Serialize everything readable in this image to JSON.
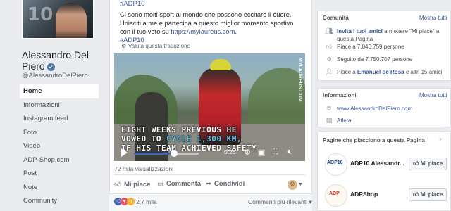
{
  "profile": {
    "photo_number": "10",
    "name": "Alessandro Del Piero",
    "verified_glyph": "✔",
    "handle": "@AlessandroDelPiero"
  },
  "nav": {
    "items": [
      "Home",
      "Informazioni",
      "Instagram feed",
      "Foto",
      "Video",
      "ADP-Shop.com",
      "Post",
      "Note",
      "Community"
    ]
  },
  "post": {
    "hashtag_top": "#ADP10",
    "text_line1": "Ci sono molti sport al mondo che possono eccitare il cuore.",
    "text_line2": "Unisciti a me e partecipa a questo miglior momento sportivo con il tuo voto su",
    "link": "https://mylaureus.com",
    "text_after_link": ".",
    "hashtag_bottom": "#ADP10",
    "translate": "Valuta questa traduzione",
    "video": {
      "watermark": "MYLAUREUS.COM",
      "caption_line1": "EIGHT WEEKS PREVIOUS HE",
      "caption_line2_a": "VOWED TO ",
      "caption_line2_b": "CYCLE 1,300 KM,",
      "caption_line3": "IF HIS TEAM ACHIEVED SAFETY",
      "progress": 0.62,
      "time": "0:26"
    },
    "views": "72 mila visualizzazioni",
    "actions": {
      "like": "Mi piace",
      "comment": "Commenta",
      "share": "Condividi"
    },
    "reactions_count": "2,7 mila",
    "comments_sort": "Commenti più rilevanti"
  },
  "community": {
    "title": "Comunità",
    "see_all": "Mostra tutti",
    "invite_link": "Invita i tuoi amici",
    "invite_rest": "a mettere \"Mi piace\" a questa Pagina",
    "likes": "Piace a 7.846.759 persone",
    "follows": "Seguito da 7.750.707 persone",
    "friends_prefix": "Piace a ",
    "friend_name": "Emanuel de Rosa",
    "friends_suffix": " e altri 15 amici"
  },
  "info": {
    "title": "Informazioni",
    "see_all": "Mostra tutti",
    "website": "www.AlessandroDelPiero.com",
    "category": "Atleta"
  },
  "liked_pages": {
    "title": "Pagine che piacciono a questa Pagina",
    "pages": [
      {
        "name": "ADP10 Alessandr...",
        "button": "Mi piace",
        "logo_text": "ADP10"
      },
      {
        "name": "ADPShop",
        "button": "Mi piace",
        "logo_text": "ADP"
      }
    ]
  },
  "colors": {
    "link": "#385898",
    "background": "#e9ebee",
    "fb_blue": "#4267b2"
  }
}
